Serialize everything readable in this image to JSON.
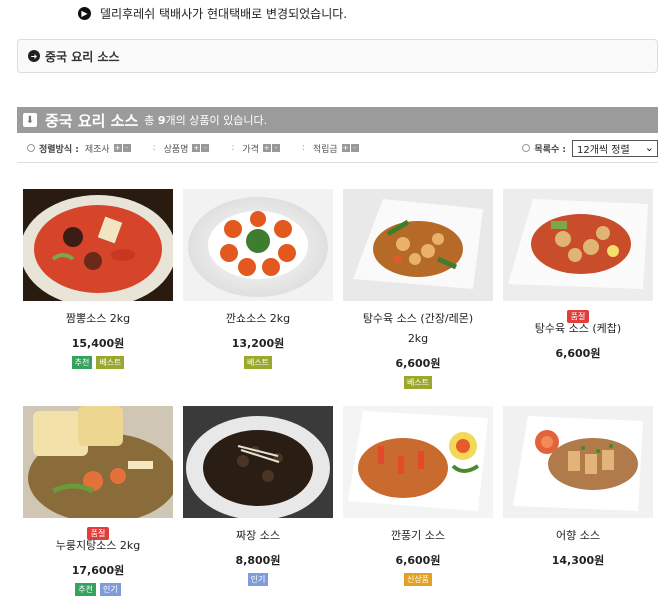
{
  "notice": {
    "text": "델리후레쉬 택배사가 현대택배로 변경되었습니다."
  },
  "category_box": {
    "title": "중국 요리 소스"
  },
  "list_header": {
    "title": "중국 요리 소스",
    "prefix": "총",
    "count": "9",
    "suffix": "개의 상품이 있습니다."
  },
  "sort": {
    "label": "정렬방식 :",
    "options": [
      "제조사",
      "상품명",
      "가격",
      "적립금"
    ],
    "list_label": "목록수 :",
    "list_value": "12개씩 정렬"
  },
  "badge_colors": {
    "추천": "#37a25e",
    "베스트": "#9aa92d",
    "인기": "#7e9cdc",
    "신상품": "#e2a126",
    "품절": "#e23d3d"
  },
  "products": [
    {
      "name": "짬뽕소스 2kg",
      "price": "15,400원",
      "badges": [
        "추천",
        "베스트"
      ],
      "soldout": false,
      "image": "spicy-seafood-soup"
    },
    {
      "name": "깐쇼소스 2kg",
      "price": "13,200원",
      "badges": [
        "베스트"
      ],
      "soldout": false,
      "image": "chili-shrimp-plate"
    },
    {
      "name": "탕수육 소스 (간장/레몬) 2kg",
      "price": "6,600원",
      "badges": [
        "베스트"
      ],
      "soldout": false,
      "image": "sweet-sour-pork-soy"
    },
    {
      "name": "탕수육 소스 (케찹)",
      "price": "6,600원",
      "badges": [],
      "soldout": true,
      "soldout_label": "품절",
      "image": "sweet-sour-pork-ketchup"
    },
    {
      "name": "누룽지탕소스 2kg",
      "price": "17,600원",
      "badges": [
        "추천",
        "인기"
      ],
      "soldout": true,
      "soldout_label": "품절",
      "image": "crispy-rice-soup"
    },
    {
      "name": "짜장 소스",
      "price": "8,800원",
      "badges": [
        "인기"
      ],
      "soldout": false,
      "image": "black-bean-sauce"
    },
    {
      "name": "깐풍기 소스",
      "price": "6,600원",
      "badges": [
        "신상품"
      ],
      "soldout": false,
      "image": "spicy-garlic-chicken"
    },
    {
      "name": "어향 소스",
      "price": "14,300원",
      "badges": [],
      "soldout": false,
      "image": "fish-flavored-pork"
    }
  ]
}
